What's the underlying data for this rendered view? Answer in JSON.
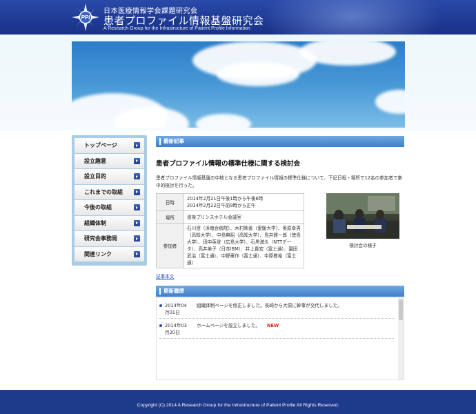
{
  "header": {
    "logo_text": "PPI",
    "org_name": "日本医療情報学会課題研究会",
    "title": "患者プロファイル情報基盤研究会",
    "subtitle": "A Research Group for the Infrastructure of Patient Profile Information"
  },
  "nav": {
    "items": [
      {
        "label": "トップページ"
      },
      {
        "label": "設立趣意"
      },
      {
        "label": "設立目的"
      },
      {
        "label": "これまでの取組"
      },
      {
        "label": "今後の取組"
      },
      {
        "label": "組織体制"
      },
      {
        "label": "研究会事務局"
      },
      {
        "label": "関連リンク"
      }
    ]
  },
  "latest": {
    "section_title": "最新記事",
    "article_title": "患者プロファイル情報の標準仕様に関する検討会",
    "intro": "患者プロファイル情報基盤の中核となる患者プロファイル情報の標準仕様について、下記日程・場所で12名の参加者で集中的検討を行った。",
    "table": {
      "date_key": "日時",
      "date_line1": "2014年2月21日午後1時から午後6時",
      "date_line2": "2014年2月22日午前9時から正午",
      "place_key": "場所",
      "place_val": "道後プリンスホテル会議室",
      "participants_key": "参加者",
      "participants_val": "石川澄（浜南会病院）、木村映善（愛媛大学）、奥原幸男（高知大学）、中島典昭（高知大学）、島井健一郎（徳島大学）、田中英登（広島大学）、石黒満久（NTTデータ）、高井美子（日本IBM）、井上貴宏（富士通）、園田武治（富士通）、中野憲作（富士通）、中原教裕（富士通）"
    },
    "photo_caption": "検討会の様子",
    "more_link": "記事本文"
  },
  "updates": {
    "section_title": "更新履歴",
    "items": [
      {
        "date": "2014年04月01日",
        "text": "組織体制ページを修正しました。長崎から大原に幹事が交代しました。",
        "new": ""
      },
      {
        "date": "2014年03月20日",
        "text": "ホームページを設立しました。",
        "new": "NEW"
      }
    ]
  },
  "footer": {
    "copyright": "Copyright (C) 2014 A Research Group for the Infrastructure of Patient Profile All Rights Reserved."
  },
  "colors": {
    "header_blue": "#1e3a94",
    "nav_frame": "#a8cce6",
    "section_head": "#4a89cf",
    "new_tag": "#e02020",
    "footer_blue": "#1e3a8a"
  }
}
